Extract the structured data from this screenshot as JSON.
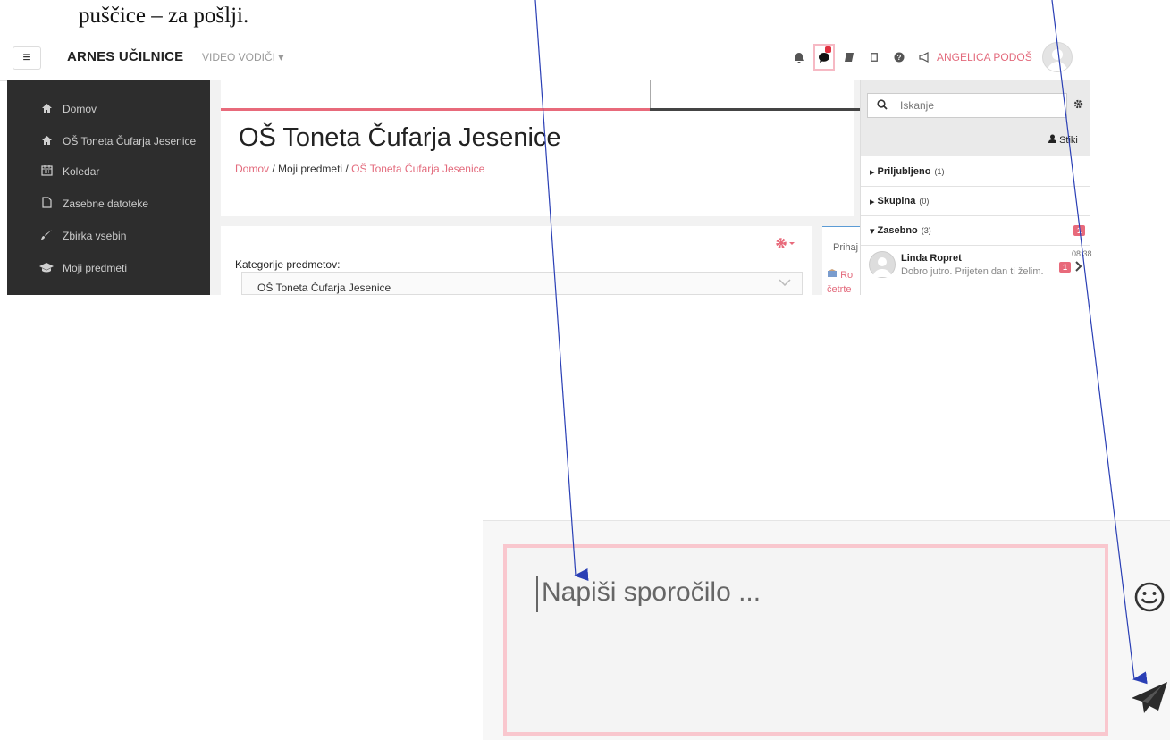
{
  "caption": "puščice – za pošlji.",
  "navbar": {
    "menu_icon": "hamburger-icon",
    "brand": "ARNES UČILNICE",
    "video_menu": "VIDEO VODIČI ▾",
    "icons": [
      "bell-icon",
      "chat-bubble-icon",
      "book-icon",
      "tablet-icon",
      "question-icon",
      "megaphone-icon"
    ],
    "username": "ANGELICA PODOŠ"
  },
  "sidebar": {
    "items": [
      {
        "label": "Domov",
        "icon": "home-icon"
      },
      {
        "label": "OŠ Toneta Čufarja Jesenice",
        "icon": "home-icon"
      },
      {
        "label": "Koledar",
        "icon": "calendar-icon"
      },
      {
        "label": "Zasebne datoteke",
        "icon": "file-icon"
      },
      {
        "label": "Zbirka vsebin",
        "icon": "brush-icon"
      },
      {
        "label": "Moji predmeti",
        "icon": "graduation-cap-icon"
      }
    ]
  },
  "main": {
    "title": "OŠ Toneta Čufarja Jesenice",
    "breadcrumb": [
      "Domov",
      "Moji predmeti",
      "OŠ Toneta Čufarja Jesenice"
    ],
    "breadcrumb_sep": "/",
    "category_label": "Kategorije predmetov:",
    "category_value": "OŠ Toneta Čufarja Jesenice",
    "side_card_title": "Prihaj",
    "side_card_link_1": "Ro",
    "side_card_link_2": "četrte"
  },
  "drawer": {
    "search_placeholder": "Iskanje",
    "contacts_label": "Stiki",
    "sections": [
      {
        "label": "Priljubljeno",
        "count": "(1)",
        "arrow": "▸"
      },
      {
        "label": "Skupina",
        "count": "(0)",
        "arrow": "▸"
      },
      {
        "label": "Zasebno",
        "count": "(3)",
        "arrow": "▾",
        "badge": "1"
      }
    ],
    "message": {
      "name": "Linda Ropret",
      "text": "Dobro jutro. Prijeten dan ti želim.",
      "time": "08:38",
      "badge": "1"
    }
  },
  "composer": {
    "placeholder": "Napiši sporočilo ...",
    "emoji_icon": "smiley-icon",
    "send_icon": "paper-plane-icon"
  },
  "colors": {
    "accent": "#e86a7b",
    "sidebar_bg": "#2d2d2d",
    "arrow": "#2a3fb5"
  }
}
